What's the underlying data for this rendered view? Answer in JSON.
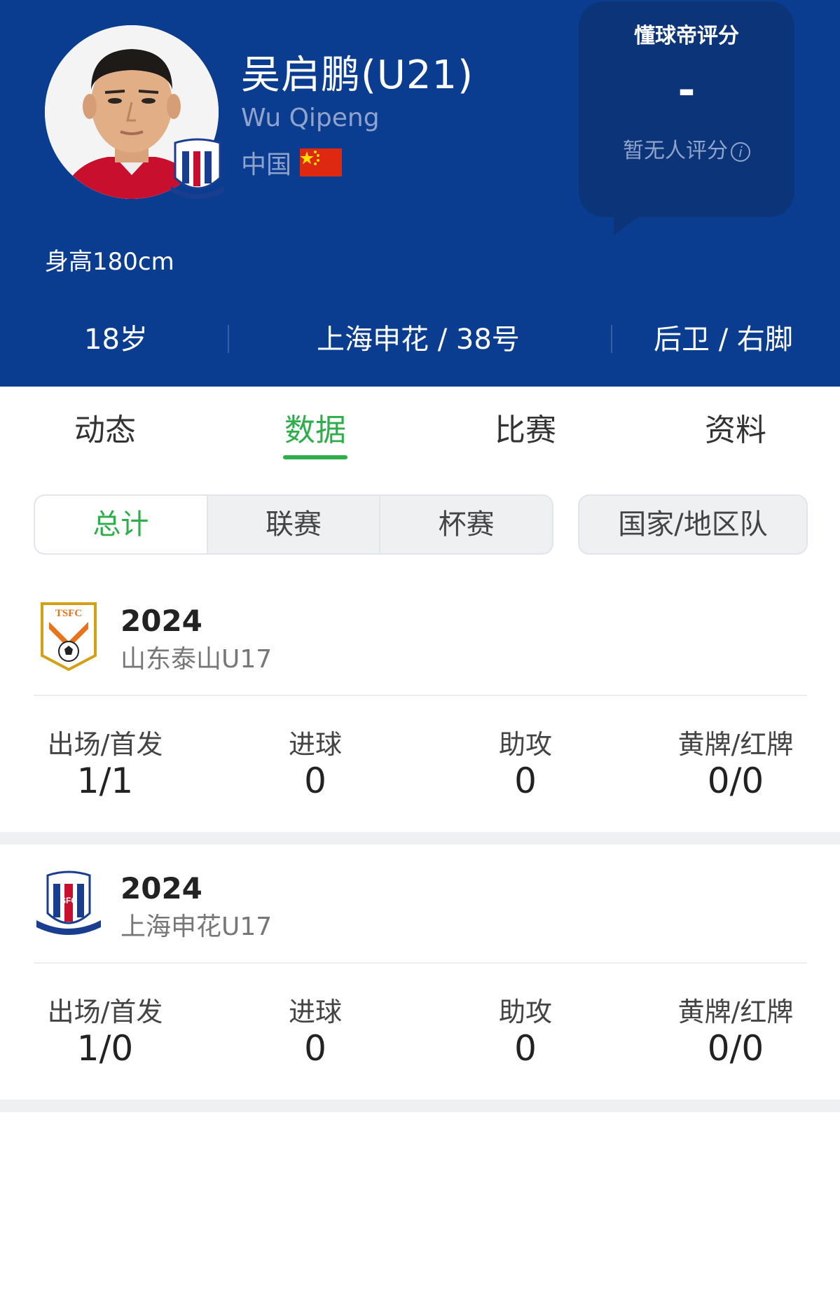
{
  "player": {
    "name": "吴启鹏(U21)",
    "name_en": "Wu Qipeng",
    "nation": "中国",
    "height": "身高180cm",
    "age": "18岁",
    "club_number": "上海申花 / 38号",
    "position_foot": "后卫 / 右脚"
  },
  "rating": {
    "title": "懂球帝评分",
    "value": "-",
    "note": "暂无人评分"
  },
  "tabs": [
    "动态",
    "数据",
    "比赛",
    "资料"
  ],
  "active_tab": "数据",
  "filters": {
    "items": [
      "总计",
      "联赛",
      "杯赛"
    ],
    "active": "总计",
    "national": "国家/地区队"
  },
  "seasons": [
    {
      "year": "2024",
      "team": "山东泰山U17",
      "stats": [
        {
          "label": "出场/首发",
          "value": "1/1"
        },
        {
          "label": "进球",
          "value": "0"
        },
        {
          "label": "助攻",
          "value": "0"
        },
        {
          "label": "黄牌/红牌",
          "value": "0/0"
        }
      ]
    },
    {
      "year": "2024",
      "team": "上海申花U17",
      "stats": [
        {
          "label": "出场/首发",
          "value": "1/0"
        },
        {
          "label": "进球",
          "value": "0"
        },
        {
          "label": "助攻",
          "value": "0"
        },
        {
          "label": "黄牌/红牌",
          "value": "0/0"
        }
      ]
    }
  ],
  "colors": {
    "header_bg": "#0a3d8f",
    "accent_green": "#2eae4a",
    "rating_bg": "#0b3578"
  },
  "logos": {
    "tsfc_text": "TSFC",
    "sfc_text": "SFC"
  }
}
